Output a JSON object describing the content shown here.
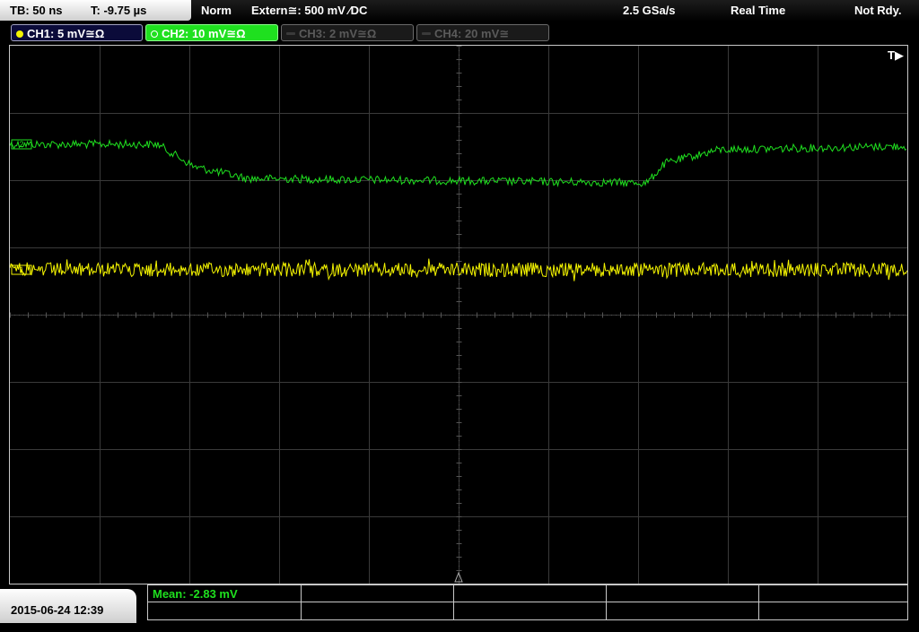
{
  "topbar": {
    "timebase": "TB: 50 ns",
    "trigger_time": "T: -9.75 µs",
    "trigger_mode": "Norm",
    "trigger_source": "Extern≅: 500 mV ⁄DC",
    "sample_rate": "2.5 GSa/s",
    "acq_mode": "Real Time",
    "status": "Not Rdy."
  },
  "channels": [
    {
      "label": "CH1: 5 mV≅Ω",
      "color": "#f5f500",
      "active": true
    },
    {
      "label": "CH2: 10 mV≅Ω",
      "color": "#1fe01f",
      "active": true,
      "selected": true
    },
    {
      "label": "CH3: 2 mV≅Ω",
      "color": "#5a5a5a",
      "active": false
    },
    {
      "label": "CH4: 20 mV≅",
      "color": "#5a5a5a",
      "active": false
    }
  ],
  "screen": {
    "trigger_marker": "T▶",
    "ch2_marker": "2",
    "ch1_marker": "1"
  },
  "colors": {
    "ch1_trace": "#f5f500",
    "ch2_trace": "#1fe01f",
    "grid": "#3a3a3a"
  },
  "footer": {
    "datetime": "2015-06-24 12:39",
    "measurement": "Mean: -2.83 mV"
  }
}
